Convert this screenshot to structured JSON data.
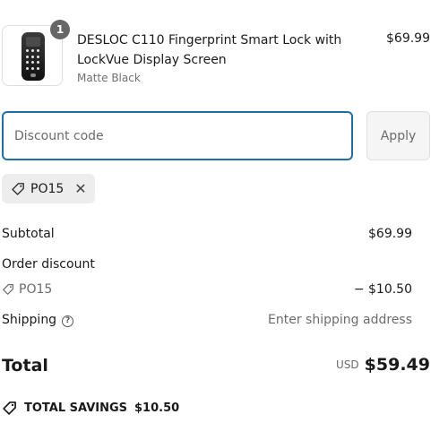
{
  "product": {
    "quantity": "1",
    "title": "DESLOC C110 Fingerprint Smart Lock with LockVue Display Screen",
    "variant": "Matte Black",
    "price": "$69.99"
  },
  "discount": {
    "placeholder": "Discount code",
    "value": "",
    "apply_label": "Apply",
    "applied_code": "PO15",
    "remove_symbol": "✕"
  },
  "summary": {
    "subtotal_label": "Subtotal",
    "subtotal_value": "$69.99",
    "order_discount_label": "Order discount",
    "discount_code": "PO15",
    "discount_value": "− $10.50",
    "shipping_label": "Shipping",
    "shipping_help_symbol": "?",
    "shipping_value": "Enter shipping address",
    "total_label": "Total",
    "currency": "USD",
    "total_value": "$59.49",
    "savings_label": "TOTAL SAVINGS",
    "savings_value": "$10.50"
  },
  "colors": {
    "focus_border": "#1e6fa8",
    "badge": "#666666",
    "chip_bg": "#ededed"
  },
  "icons": {
    "tag": "tag-icon",
    "help": "question-circle-icon",
    "remove": "close-icon"
  }
}
